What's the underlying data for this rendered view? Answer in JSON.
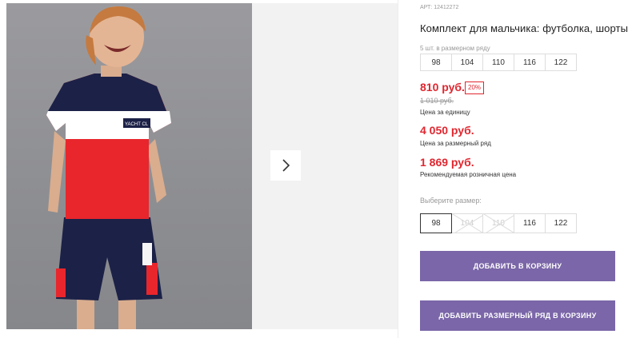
{
  "product": {
    "art_label": "АРТ:",
    "art_number": "12412272",
    "title": "Комплект для мальчика: футболка, шорты",
    "row_hint": "5 шт. в размерном ряду",
    "row_sizes": [
      "98",
      "104",
      "110",
      "116",
      "122"
    ]
  },
  "pricing": {
    "price": "810 руб.",
    "discount_badge": "20%",
    "old_price": "1 010 руб.",
    "unit_label": "Цена за единицу",
    "row_price": "4 050 руб.",
    "row_price_label": "Цена за размерный ряд",
    "retail_price": "1 869 руб.",
    "retail_price_label": "Рекомендуемая розничная цена"
  },
  "size_picker": {
    "label": "Выберите размер:",
    "sizes": [
      "98",
      "104",
      "110",
      "116",
      "122"
    ],
    "selected": "98",
    "disabled": [
      "104",
      "110"
    ]
  },
  "actions": {
    "add_to_cart": "ДОБАВИТЬ В КОРЗИНУ",
    "add_row_to_cart": "ДОБАВИТЬ РАЗМЕРНЫЙ РЯД В КОРЗИНУ"
  },
  "photo": {
    "shirt_print": "YACHT CL"
  },
  "icons": {
    "next": "chevron-right-icon"
  },
  "colors": {
    "accent_red": "#e0262f",
    "button_purple": "#7a66a8",
    "shirt_navy": "#1c2147",
    "shirt_red": "#e8262c"
  }
}
